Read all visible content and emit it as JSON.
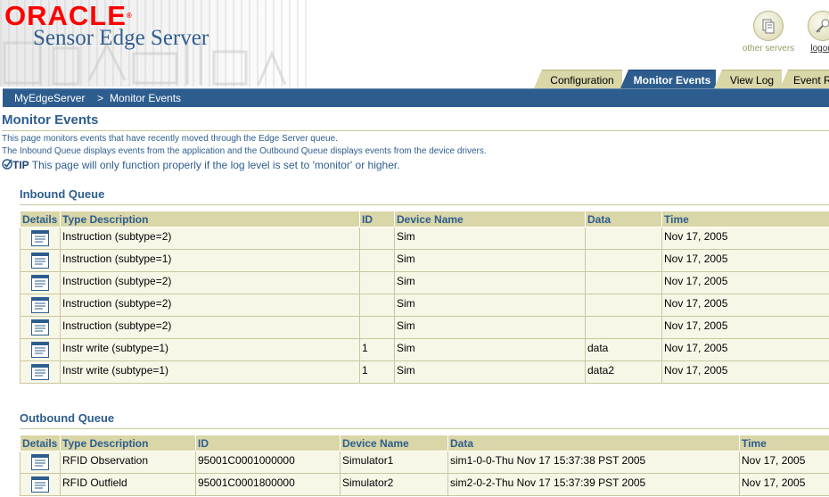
{
  "branding": {
    "company": "ORACLE",
    "product": "Sensor Edge Server"
  },
  "global_links": [
    {
      "label": "other servers",
      "icon": "servers-icon"
    },
    {
      "label": "logout",
      "icon": "key-icon"
    }
  ],
  "tabs": [
    {
      "label": "Configuration",
      "active": false
    },
    {
      "label": "Monitor Events",
      "active": true
    },
    {
      "label": "View Log",
      "active": false
    },
    {
      "label": "Event R",
      "active": false
    }
  ],
  "breadcrumb": {
    "server": "MyEdgeServer",
    "separator": ">",
    "current": "Monitor Events"
  },
  "page": {
    "title": "Monitor Events",
    "desc1": "This page monitors events that have recently moved through the Edge Server queue.",
    "desc2": "The Inbound Queue displays events from the application and the Outbound Queue displays events from the device drivers.",
    "tip_label": "TIP",
    "tip_text": " This page will only function properly if the log level is set to 'monitor' or higher."
  },
  "inbound": {
    "title": "Inbound Queue",
    "columns": [
      "Details",
      "Type Description",
      "ID",
      "Device Name",
      "Data",
      "Time"
    ],
    "rows": [
      {
        "type": "Instruction (subtype=2)",
        "id": "",
        "device": "Sim",
        "data": "",
        "time": "Nov 17, 2005"
      },
      {
        "type": "Instruction (subtype=1)",
        "id": "",
        "device": "Sim",
        "data": "",
        "time": "Nov 17, 2005"
      },
      {
        "type": "Instruction (subtype=2)",
        "id": "",
        "device": "Sim",
        "data": "",
        "time": "Nov 17, 2005"
      },
      {
        "type": "Instruction (subtype=2)",
        "id": "",
        "device": "Sim",
        "data": "",
        "time": "Nov 17, 2005"
      },
      {
        "type": "Instruction (subtype=2)",
        "id": "",
        "device": "Sim",
        "data": "",
        "time": "Nov 17, 2005"
      },
      {
        "type": "Instr write (subtype=1)",
        "id": "1",
        "device": "Sim",
        "data": "data",
        "time": "Nov 17, 2005"
      },
      {
        "type": "Instr write (subtype=1)",
        "id": "1",
        "device": "Sim",
        "data": "data2",
        "time": "Nov 17, 2005"
      }
    ]
  },
  "outbound": {
    "title": "Outbound Queue",
    "columns": [
      "Details",
      "Type Description",
      "ID",
      "Device Name",
      "Data",
      "Time"
    ],
    "rows": [
      {
        "type": "RFID Observation",
        "id": "95001C0001000000",
        "device": "Simulator1",
        "data": "sim1-0-0-Thu Nov 17 15:37:38 PST 2005",
        "time": "Nov 17, 2005"
      },
      {
        "type": "RFID Outfield",
        "id": "95001C0001800000",
        "device": "Simulator2",
        "data": "sim2-0-2-Thu Nov 17 15:37:39 PST 2005",
        "time": "Nov 17, 2005"
      }
    ]
  },
  "colors": {
    "accent": "#2d5d8e",
    "tab": "#d9d6a8",
    "row": "#f7f7e7",
    "brand": "#ff0000"
  }
}
